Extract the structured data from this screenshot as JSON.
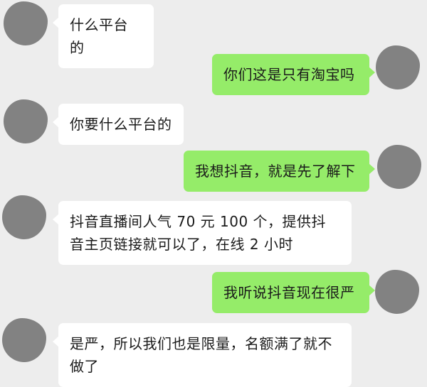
{
  "colors": {
    "background": "#ededed",
    "incoming_bubble": "#ffffff",
    "outgoing_bubble": "#95ec69",
    "text": "#1a1a1a",
    "avatar_blur": "#828282"
  },
  "messages": [
    {
      "side": "incoming",
      "text": "什么平台的"
    },
    {
      "side": "outgoing",
      "text": "你们这是只有淘宝吗"
    },
    {
      "side": "incoming",
      "text": "你要什么平台的"
    },
    {
      "side": "outgoing",
      "text": "我想抖音，就是先了解下"
    },
    {
      "side": "incoming",
      "text": "抖音直播间人气 70 元 100 个，提供抖音主页链接就可以了，在线 2 小时"
    },
    {
      "side": "outgoing",
      "text": "我听说抖音现在很严"
    },
    {
      "side": "incoming",
      "text": "是严，所以我们也是限量，名额满了就不做了"
    }
  ]
}
